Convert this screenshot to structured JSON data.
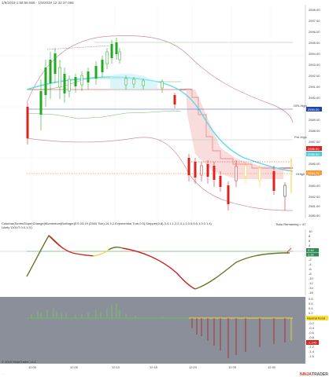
{
  "header": {
    "title": "1/9/2019 1:58:58.656 - 1/9/2019 12:32:37.066"
  },
  "price_axis": {
    "labels": [
      "2598.00",
      "2597.00",
      "2596.00",
      "2595.00",
      "2594.00",
      "2593.00",
      "2592.00",
      "2591.00",
      "2590.00",
      "2589.00",
      "2588.00",
      "2587.00",
      "2586.00",
      "2585.00",
      "2584.00",
      "2583.00",
      "2582.00",
      "2581.00",
      "2580.00"
    ]
  },
  "price_tags": {
    "orh_high_label": "ORI-High",
    "orh_high_value": "2590.00",
    "pre_high_label": "Pre-High",
    "red_value": "2586.00",
    "blue_value": "2585.50",
    "hh_label": "HHigh",
    "orange_value": "2584.75"
  },
  "ticks_remaining": "Ticks Remaining = 47",
  "oscillator": {
    "title": "Colorbar(SeriesSlope)Change(Momentum)Bollinger(ES 03-19 (2500 Tick),14,3,2,Exponential,True,0.0),Stopper(0.8),3,4,1,1,2,2,4,1,1,0.5,0.5,1.0,0.1,4)",
    "subtitle": "Likely 'DOUT 0.0.1.5')",
    "axis_labels": [
      "10",
      "8",
      "6",
      "4",
      "2",
      "0",
      "-2",
      "-4",
      "-6",
      "-8",
      "-10",
      "-12",
      "-14",
      "-16"
    ],
    "value_tag_1": "3.44",
    "value_tag_2": "1.32"
  },
  "histogram": {
    "axis_labels": [
      "0.8",
      "0.6",
      "0.4",
      "0.2",
      "0",
      "-0.2",
      "-0.4",
      "-0.6",
      "-0.8",
      "-1",
      "-1.2",
      "-1.4",
      "-1.6"
    ],
    "neutral_label": "Neutral trend",
    "value_tag": "-1.245"
  },
  "time_axis": {
    "labels": [
      "12:00",
      "12:05",
      "12:10",
      "12:15",
      "12:20",
      "12:25",
      "12:30"
    ]
  },
  "footer": {
    "copyright": "© 2019 NinjaTrader, LLC",
    "brand_prefix": "NINJA",
    "brand_suffix": "TRADER",
    "footer_left": "..."
  },
  "colors": {
    "up_candle": "#22aa22",
    "down_candle": "#dd2222",
    "ema_cyan": "#55ddee",
    "bb_pink": "#d08aa0",
    "osc_bg": "#8a8f9a"
  }
}
